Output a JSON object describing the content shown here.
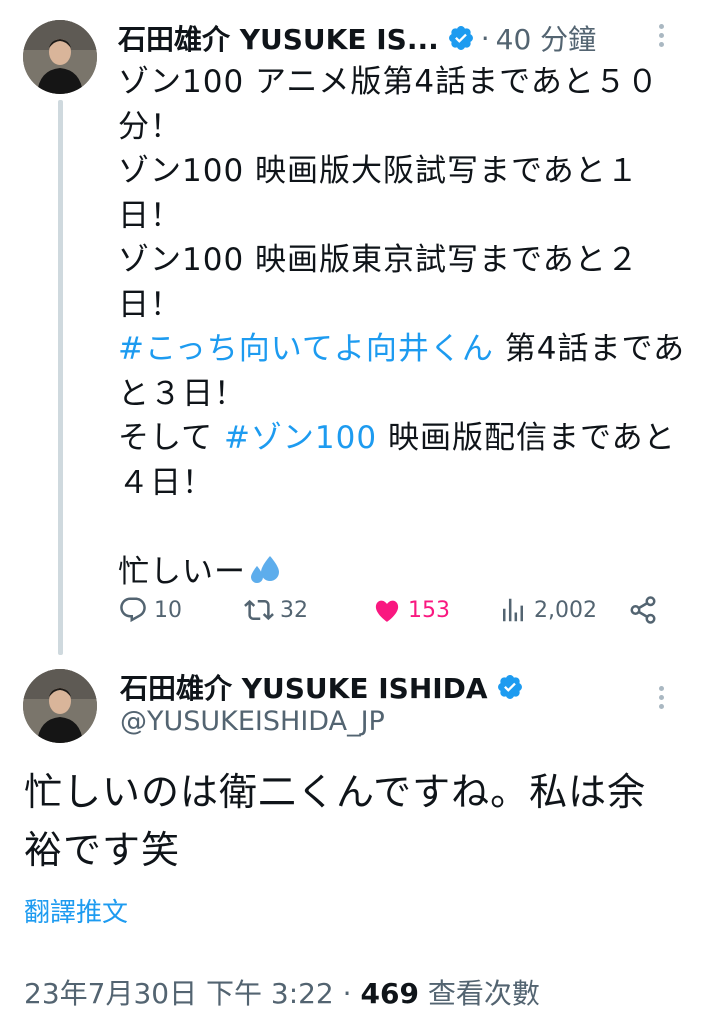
{
  "parent_tweet": {
    "display_name": "石田雄介 YUSUKE IS...",
    "separator": "·",
    "time_ago": "40 分鐘",
    "text_lines": [
      [
        {
          "t": "ゾン100 アニメ版第4話まであと５０"
        }
      ],
      [
        {
          "t": "分！"
        }
      ],
      [
        {
          "t": "ゾン100 映画版大阪試写まであと１"
        }
      ],
      [
        {
          "t": "日！"
        }
      ],
      [
        {
          "t": "ゾン100 映画版東京試写まであと２"
        }
      ],
      [
        {
          "t": "日！"
        }
      ],
      [
        {
          "t": "#こっち向いてよ向井くん",
          "tag": true
        },
        {
          "t": " 第4話まであ"
        }
      ],
      [
        {
          "t": "と３日！"
        }
      ],
      [
        {
          "t": "そして "
        },
        {
          "t": "#ゾン100",
          "tag": true
        },
        {
          "t": " 映画版配信まであと"
        }
      ],
      [
        {
          "t": "４日！"
        }
      ],
      [
        {
          "t": ""
        }
      ],
      [
        {
          "t": "忙しいー"
        },
        {
          "emoji": "sweat-droplets-icon"
        }
      ]
    ],
    "stats": {
      "replies": "10",
      "retweets": "32",
      "likes": "153",
      "views": "2,002"
    }
  },
  "reply_tweet": {
    "display_name": "石田雄介 YUSUKE ISHIDA",
    "handle": "@YUSUKEISHIDA_JP",
    "text_lines": [
      "忙しいのは衛二くんですね。私は余",
      "裕です笑"
    ],
    "translate_label": "翻譯推文",
    "timestamp": "23年7月30日 下午 3:22",
    "separator": "·",
    "view_count": "469",
    "view_label": "查看次數"
  },
  "colors": {
    "accent_blue": "#1d9bf0",
    "like_pink": "#f91880",
    "secondary_text": "#536471",
    "thread_line": "#cfd9de"
  }
}
